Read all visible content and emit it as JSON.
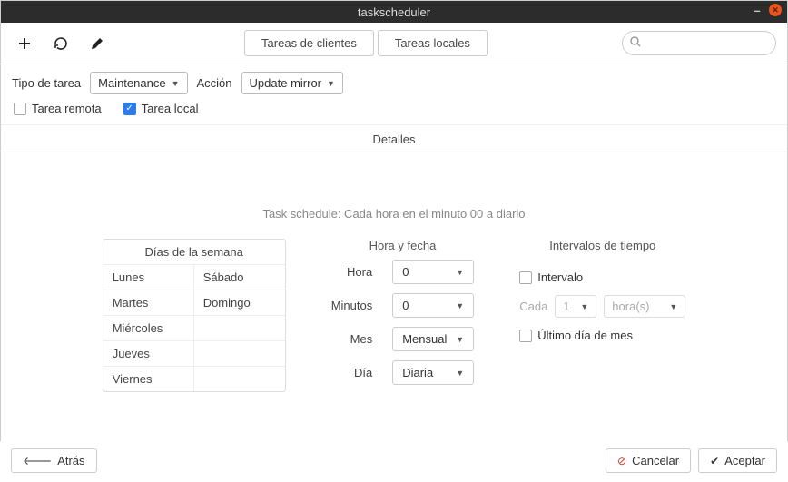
{
  "window": {
    "title": "taskscheduler"
  },
  "toolbar": {
    "tabs": {
      "clients": "Tareas de clientes",
      "local": "Tareas locales"
    },
    "search_placeholder": ""
  },
  "form": {
    "task_type_label": "Tipo de tarea",
    "task_type_value": "Maintenance",
    "action_label": "Acción",
    "action_value": "Update mirror",
    "remote_task_label": "Tarea remota",
    "local_task_label": "Tarea local"
  },
  "details": {
    "header": "Detalles",
    "schedule_desc": "Task schedule: Cada hora en el minuto 00 a diario"
  },
  "days": {
    "title": "Días de la semana",
    "lunes": "Lunes",
    "martes": "Martes",
    "miercoles": "Miércoles",
    "jueves": "Jueves",
    "viernes": "Viernes",
    "sabado": "Sábado",
    "domingo": "Domingo"
  },
  "hourdate": {
    "title": "Hora y fecha",
    "hour_label": "Hora",
    "hour_value": "0",
    "minute_label": "Minutos",
    "minute_value": "0",
    "month_label": "Mes",
    "month_value": "Mensual",
    "day_label": "Día",
    "day_value": "Diaria"
  },
  "intervals": {
    "title": "Intervalos de tiempo",
    "interval_label": "Intervalo",
    "each_label": "Cada",
    "each_value": "1",
    "unit_value": "hora(s)",
    "last_day_label": "Último día de mes"
  },
  "footer": {
    "back": "Atrás",
    "cancel": "Cancelar",
    "accept": "Aceptar"
  }
}
